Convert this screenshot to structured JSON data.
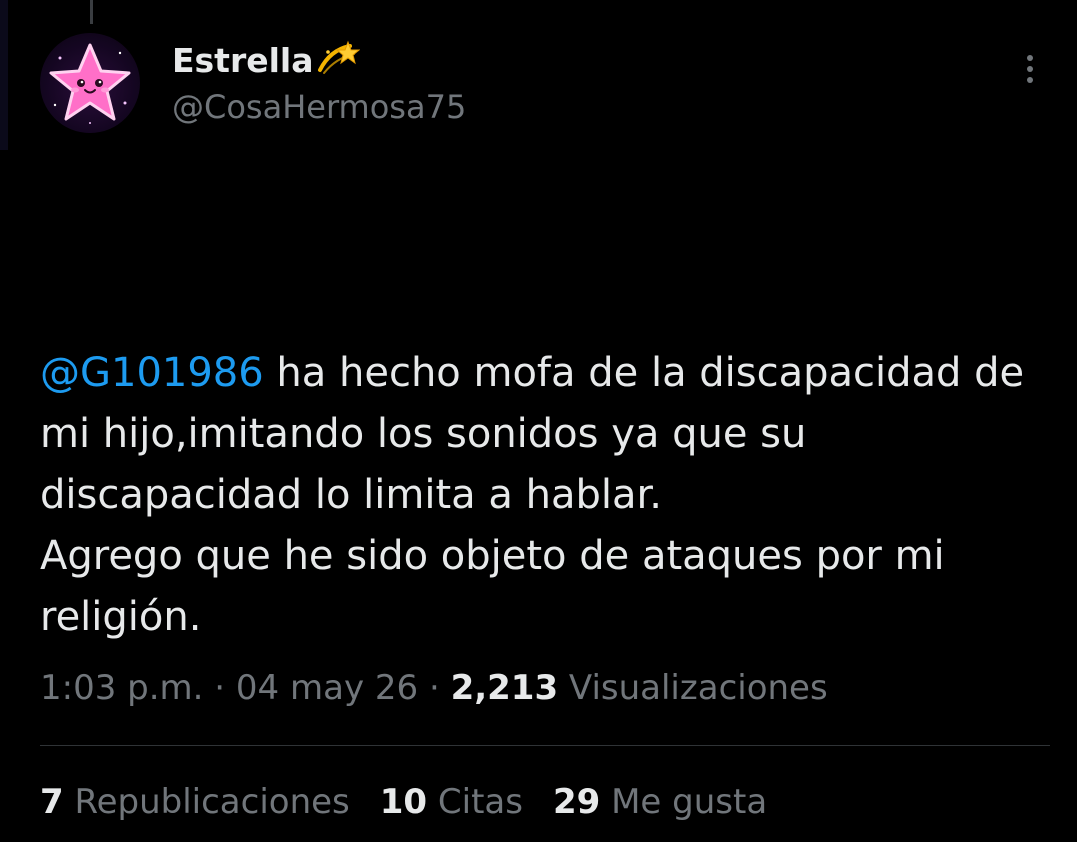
{
  "author": {
    "display_name": "Estrella",
    "name_emoji": "dizzy-star-emoji",
    "handle": "@CosaHermosa75",
    "avatar": "pink-kawaii-star-avatar"
  },
  "menu": {
    "icon": "more-vertical-icon"
  },
  "tweet": {
    "mention": "@G101986",
    "line1_rest": " ha hecho mofa de la discapacidad de mi hijo,imitando los sonidos ya que su discapacidad lo limita a hablar.",
    "line2": "Agrego que he sido objeto de ataques por mi religión."
  },
  "meta": {
    "time": "1:03 p.m.",
    "sep1": " · ",
    "date": "04 may 26",
    "sep2": " · ",
    "views_count": "2,213",
    "views_label": " Visualizaciones"
  },
  "stats": {
    "reposts_count": "7",
    "reposts_label": " Republicaciones",
    "quotes_count": "10",
    "quotes_label": " Citas",
    "likes_count": "29",
    "likes_label": " Me gusta"
  },
  "colors": {
    "background": "#000000",
    "text": "#e7e9ea",
    "secondary": "#71767b",
    "link": "#1d9bf0",
    "divider": "#2f3336"
  }
}
